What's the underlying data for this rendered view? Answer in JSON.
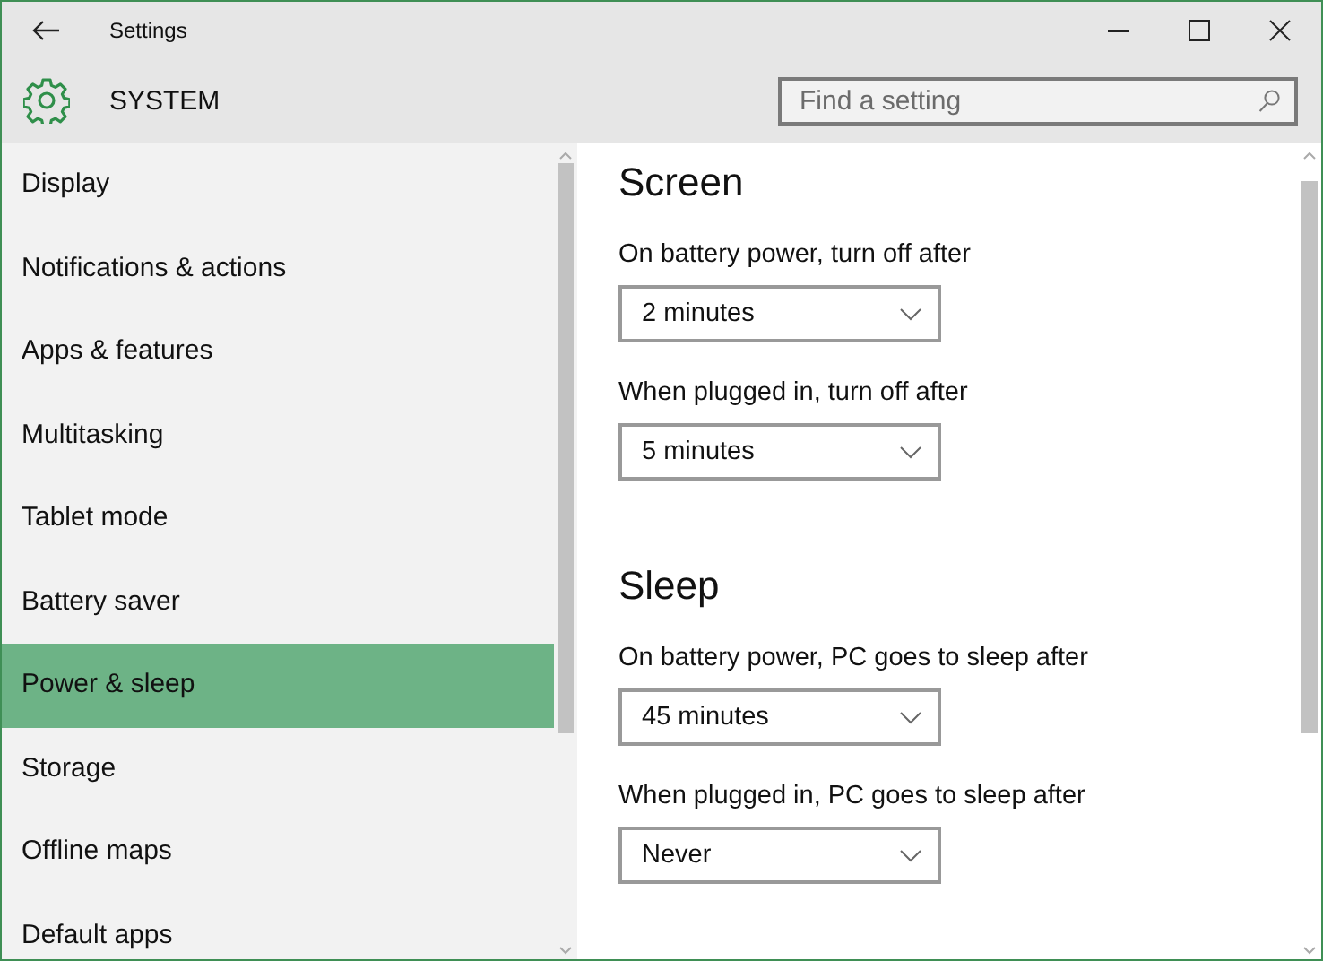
{
  "window": {
    "title": "Settings"
  },
  "header": {
    "title": "SYSTEM"
  },
  "search": {
    "placeholder": "Find a setting"
  },
  "sidebar": {
    "items": [
      {
        "label": "Display",
        "selected": false
      },
      {
        "label": "Notifications & actions",
        "selected": false
      },
      {
        "label": "Apps & features",
        "selected": false
      },
      {
        "label": "Multitasking",
        "selected": false
      },
      {
        "label": "Tablet mode",
        "selected": false
      },
      {
        "label": "Battery saver",
        "selected": false
      },
      {
        "label": "Power & sleep",
        "selected": true
      },
      {
        "label": "Storage",
        "selected": false
      },
      {
        "label": "Offline maps",
        "selected": false
      },
      {
        "label": "Default apps",
        "selected": false
      }
    ]
  },
  "sections": [
    {
      "title": "Screen",
      "settings": [
        {
          "label": "On battery power, turn off after",
          "value": "2 minutes"
        },
        {
          "label": "When plugged in, turn off after",
          "value": "5 minutes"
        }
      ]
    },
    {
      "title": "Sleep",
      "settings": [
        {
          "label": "On battery power, PC goes to sleep after",
          "value": "45 minutes"
        },
        {
          "label": "When plugged in, PC goes to sleep after",
          "value": "Never"
        }
      ]
    }
  ]
}
